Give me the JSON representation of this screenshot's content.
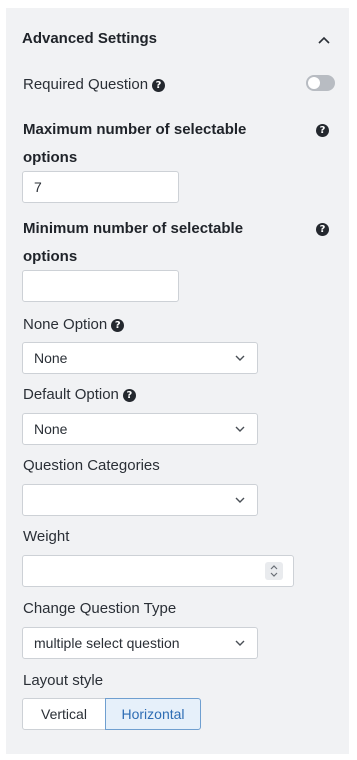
{
  "section": {
    "title": "Advanced Settings",
    "collapse_icon": "chevron-up-icon"
  },
  "required_question": {
    "label": "Required Question",
    "help_icon": "question-circle-icon",
    "toggle_on": false
  },
  "max_options": {
    "label": "Maximum number of selectable options",
    "value": "7"
  },
  "min_options": {
    "label": "Minimum number of selectable options",
    "value": ""
  },
  "none_option": {
    "label": "None Option",
    "selected": "None"
  },
  "default_option": {
    "label": "Default Option",
    "selected": "None"
  },
  "question_categories": {
    "label": "Question Categories",
    "selected": ""
  },
  "weight": {
    "label": "Weight",
    "value": ""
  },
  "question_type": {
    "label": "Change Question Type",
    "selected": "multiple select question"
  },
  "layout_style": {
    "label": "Layout style",
    "options": [
      "Vertical",
      "Horizontal"
    ],
    "active": "Horizontal"
  },
  "colors": {
    "panel_bg": "#f1f2f4",
    "accent": "#2e6db4",
    "toggle_off": "#b8bcc2"
  }
}
